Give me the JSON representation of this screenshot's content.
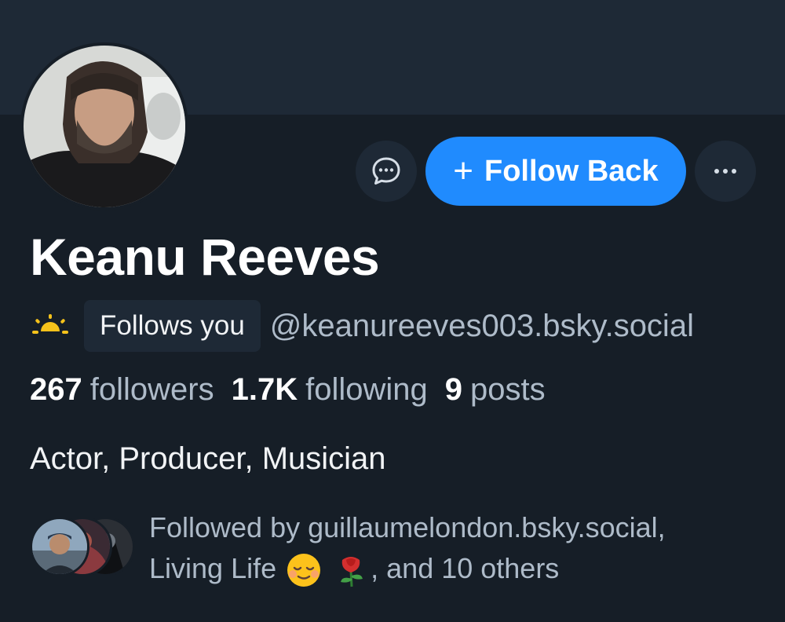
{
  "profile": {
    "name": "Keanu Reeves",
    "follows_you_label": "Follows you",
    "handle": "@keanureeves003.bsky.social",
    "status_icon": "sun-icon",
    "bio": "Actor, Producer, Musician"
  },
  "actions": {
    "message_icon": "chat-bubble-icon",
    "follow_plus": "+",
    "follow_label": "Follow Back",
    "more_icon": "ellipsis-icon"
  },
  "stats": {
    "followers_count": "267",
    "followers_label": "followers",
    "following_count": "1.7K",
    "following_label": "following",
    "posts_count": "9",
    "posts_label": "posts"
  },
  "known_followers": {
    "prefix": "Followed by guillaumelondon.bsky.social,",
    "name2": "Living Life",
    "emojis": [
      "relieved-smile-emoji",
      "rose-emoji"
    ],
    "suffix": ", and 10 others"
  },
  "colors": {
    "background": "#161e27",
    "banner": "#1e2936",
    "accent": "#208bfe",
    "muted_text": "#aebbc9"
  }
}
